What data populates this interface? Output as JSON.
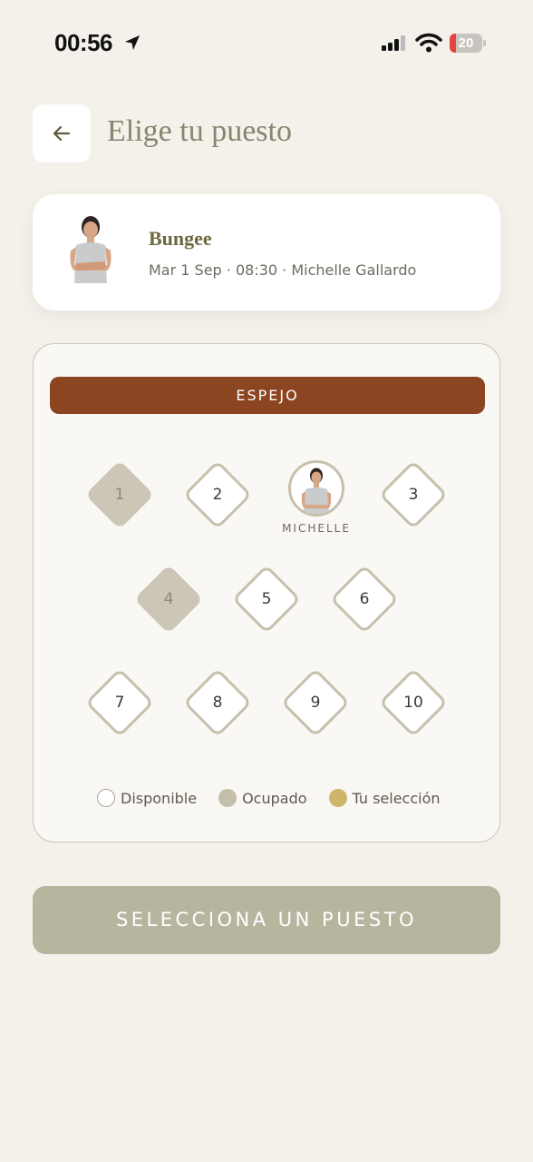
{
  "status_bar": {
    "time": "00:56",
    "battery": "20",
    "battery_fraction": 0.2,
    "icons": [
      "location-arrow-icon",
      "signal-icon",
      "wifi-icon",
      "battery-icon"
    ]
  },
  "header": {
    "title": "Elige tu puesto",
    "back_icon": "arrow-left-icon"
  },
  "class_card": {
    "name": "Bungee",
    "details": "Mar 1 Sep · 08:30 · Michelle Gallardo"
  },
  "seat_map": {
    "mirror_label": "ESPEJO",
    "instructor_label": "MICHELLE",
    "seats": [
      {
        "number": "1",
        "status": "occupied"
      },
      {
        "number": "2",
        "status": "available"
      },
      {
        "number": "3",
        "status": "available"
      },
      {
        "number": "4",
        "status": "occupied"
      },
      {
        "number": "5",
        "status": "available"
      },
      {
        "number": "6",
        "status": "available"
      },
      {
        "number": "7",
        "status": "available"
      },
      {
        "number": "8",
        "status": "available"
      },
      {
        "number": "9",
        "status": "available"
      },
      {
        "number": "10",
        "status": "available"
      }
    ],
    "legend": {
      "available": "Disponible",
      "occupied": "Ocupado",
      "selected": "Tu selección"
    }
  },
  "cta": {
    "label": "SELECCIONA UN PUESTO"
  },
  "colors": {
    "background": "#f4f0ea",
    "mirror": "#8b4520",
    "occupied": "#cbc6b6",
    "selected": "#cdb56a",
    "cta": "#b8b59f"
  }
}
